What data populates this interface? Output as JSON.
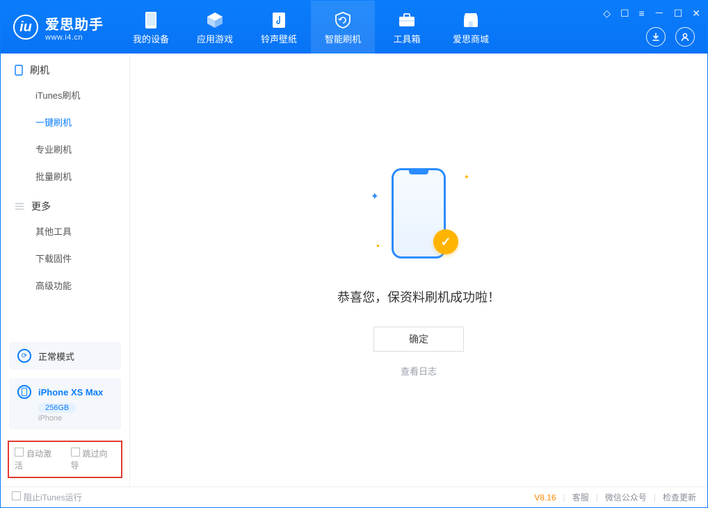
{
  "app": {
    "name_cn": "爱思助手",
    "name_en": "www.i4.cn",
    "logo_letter": "iu"
  },
  "nav": {
    "items": [
      {
        "label": "我的设备",
        "icon": "device"
      },
      {
        "label": "应用游戏",
        "icon": "cube"
      },
      {
        "label": "铃声壁纸",
        "icon": "music"
      },
      {
        "label": "智能刷机",
        "icon": "refresh",
        "active": true
      },
      {
        "label": "工具箱",
        "icon": "toolbox"
      },
      {
        "label": "爱思商城",
        "icon": "store"
      }
    ]
  },
  "sidebar": {
    "section1": {
      "title": "刷机"
    },
    "items1": [
      {
        "label": "iTunes刷机"
      },
      {
        "label": "一键刷机",
        "active": true
      },
      {
        "label": "专业刷机"
      },
      {
        "label": "批量刷机"
      }
    ],
    "section2": {
      "title": "更多"
    },
    "items2": [
      {
        "label": "其他工具"
      },
      {
        "label": "下载固件"
      },
      {
        "label": "高级功能"
      }
    ],
    "mode": {
      "label": "正常模式"
    },
    "device": {
      "name": "iPhone XS Max",
      "capacity": "256GB",
      "type": "iPhone"
    },
    "checkboxes": {
      "auto_activate": "自动激活",
      "skip_guide": "跳过向导"
    }
  },
  "main": {
    "success_msg": "恭喜您，保资料刷机成功啦！",
    "ok_btn": "确定",
    "log_link": "查看日志"
  },
  "footer": {
    "block_itunes": "阻止iTunes运行",
    "version": "V8.16",
    "links": [
      "客服",
      "微信公众号",
      "检查更新"
    ]
  }
}
